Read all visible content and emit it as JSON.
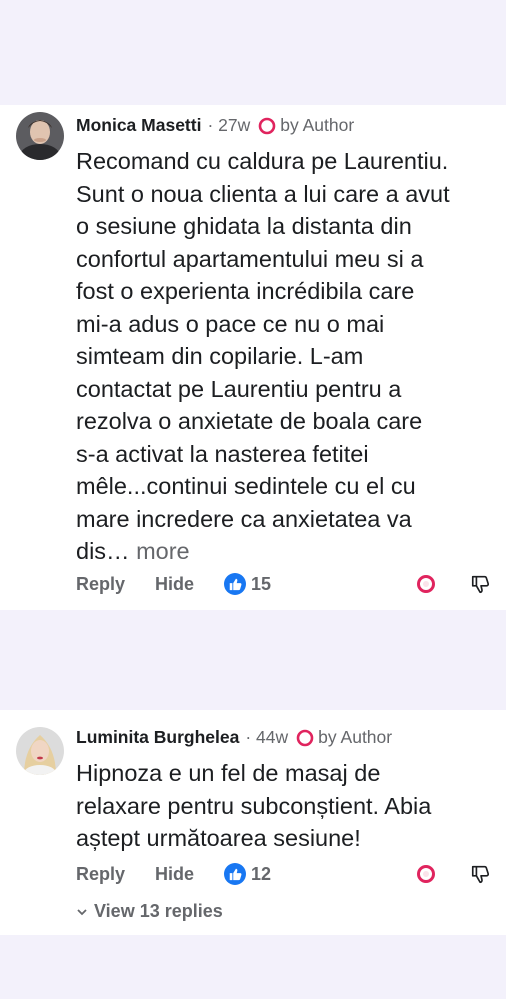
{
  "comments": [
    {
      "author": "Monica Masetti",
      "time": "· 27w",
      "badge": "by Author",
      "text": "Recomand cu caldura pe Laurentiu.\nSunt o noua clienta a lui care a avut\no sesiune ghidata la distanta din\nconfortul apartamentului meu si a\nfost o experienta incrédibila care\nmi-a adus o pace ce nu o mai\nsimteam din copilarie. L-am\ncontactat pe Laurentiu pentru a\nrezolva o anxietate de boala care\ns-a activat la nasterea fetitei\nmêle...continui sedintele cu el cu\nmare incredere ca anxietatea va\ndis…",
      "more": "more",
      "reply": "Reply",
      "hide": "Hide",
      "likes": "15"
    },
    {
      "author": "Luminita Burghelea",
      "time": "· 44w",
      "badge": "by Author",
      "text": "Hipnoza e un fel de masaj de\nrelaxare pentru subconștient. Abia\naștept următoarea sesiune!",
      "reply": "Reply",
      "hide": "Hide",
      "likes": "12",
      "view_replies": "View 13 replies"
    }
  ],
  "colors": {
    "background": "#f3f1fb",
    "card": "#ffffff",
    "like_blue": "#1877f2",
    "heart_red": "#e0245e",
    "muted": "#65676b"
  },
  "icons": [
    "heart-outline-icon",
    "thumbs-up-icon",
    "heart-icon",
    "thumbs-down-icon",
    "chevron-down-icon"
  ]
}
